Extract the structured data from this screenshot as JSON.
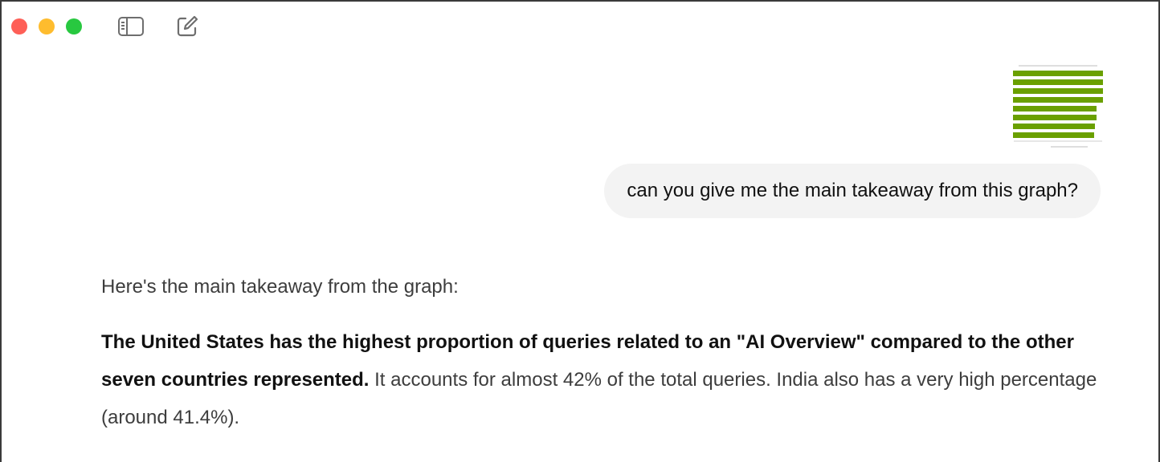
{
  "window": {
    "controls": [
      "close",
      "minimize",
      "maximize"
    ],
    "colors": {
      "close": "#fe5f57",
      "minimize": "#febc2e",
      "maximize": "#28c840"
    }
  },
  "toolbar": {
    "sidebar_icon": "sidebar-toggle-icon",
    "new_chat_icon": "new-chat-icon"
  },
  "conversation": {
    "user_message": {
      "attachment": {
        "type": "chart-thumbnail",
        "bar_color": "#6aa000",
        "bar_count": 8
      },
      "text": "can you give me the main takeaway from this graph?"
    },
    "assistant_message": {
      "intro": "Here's the main takeaway from the graph:",
      "bold": "The United States has the highest proportion of queries related to an \"AI Overview\" compared to the other seven countries represented.",
      "rest": " It accounts for almost 42% of the total queries. India also has a very high percentage (around 41.4%)."
    }
  }
}
